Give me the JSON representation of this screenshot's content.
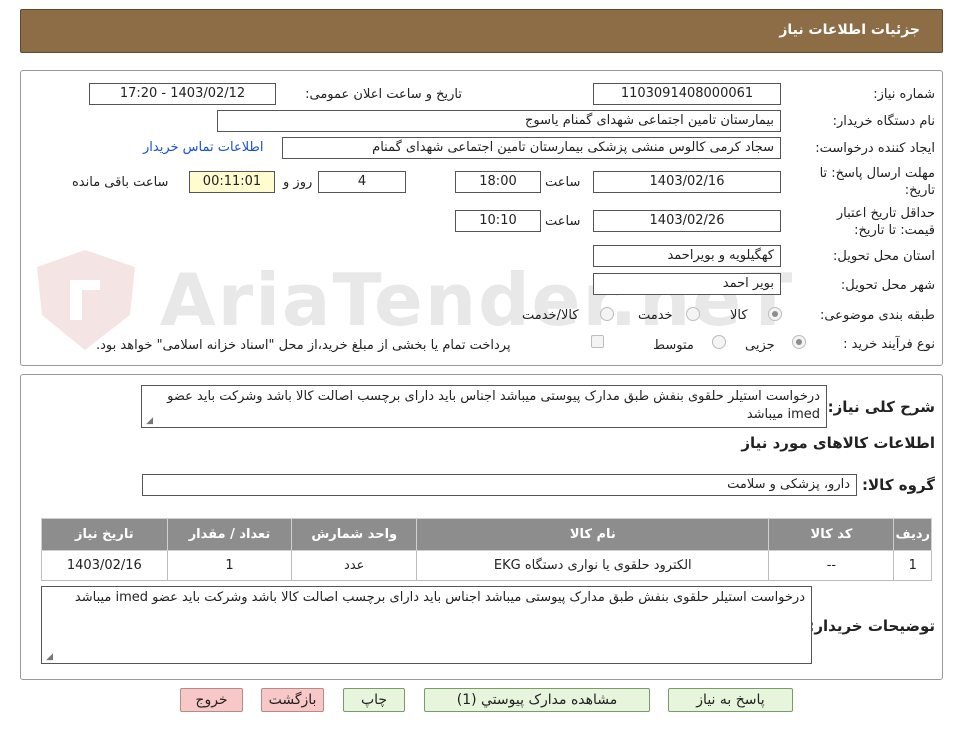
{
  "header": {
    "title": "جزئیات اطلاعات نیاز"
  },
  "labels": {
    "need_number": "شماره نیاز:",
    "announce_datetime": "تاریخ و ساعت اعلان عمومی:",
    "buyer_org": "نام دستگاه خریدار:",
    "creator": "ایجاد کننده درخواست:",
    "buyer_contact_link": "اطلاعات تماس خریدار",
    "reply_deadline_1": "مهلت ارسال پاسخ: تا",
    "reply_deadline_2": "تاریخ:",
    "time": "ساعت",
    "day_and": "روز و",
    "hours_left": "ساعت باقی مانده",
    "validity_1": "حداقل تاریخ اعتبار",
    "validity_2": "قیمت: تا تاریخ:",
    "province": "استان محل تحویل:",
    "city": "شهر محل تحویل:",
    "category": "طبقه بندی موضوعی:",
    "process_type": "نوع فرآیند خرید :",
    "general_desc": "شرح کلی نیاز:",
    "goods_info": "اطلاعات کالاهای مورد نیاز",
    "goods_group": "گروه کالا:",
    "buyer_notes": "توضیحات خریدار:"
  },
  "values": {
    "need_number": "1103091408000061",
    "announce_datetime": "1403/02/12 - 17:20",
    "buyer_org": "بیمارستان تامین اجتماعی شهدای گمنام یاسوج",
    "creator": "سجاد کرمی کالوس  منشی پزشکی  بیمارستان تامین اجتماعی شهدای گمنام",
    "reply_date": "1403/02/16",
    "reply_time": "18:00",
    "days": "4",
    "remaining": "00:11:01",
    "validity_date": "1403/02/26",
    "validity_time": "10:10",
    "province": "کهگیلویه و بویراحمد",
    "city": "بویر احمد",
    "general_desc": "درخواست استیلر حلقوی بنفش طبق مدارک پیوستی  میباشد اجناس باید دارای برچسب اصالت کالا باشد وشرکت باید عضو imed میباشد",
    "goods_group": "دارو، پزشکی و سلامت",
    "buyer_notes": "درخواست استیلر حلقوی بنفش طبق مدارک پیوستی  میباشد اجناس باید دارای برچسب اصالت کالا باشد وشرکت باید عضو imed میباشد"
  },
  "category_options": [
    "کالا",
    "خدمت",
    "کالا/خدمت"
  ],
  "category_selected": "کالا",
  "process_options": [
    "جزیی",
    "متوسط"
  ],
  "process_selected": "جزیی",
  "treasury_note": "پرداخت تمام یا بخشی از مبلغ خرید،از محل \"اسناد خزانه اسلامی\" خواهد بود.",
  "table": {
    "headers": [
      "ردیف",
      "کد کالا",
      "نام کالا",
      "واحد شمارش",
      "تعداد / مقدار",
      "تاریخ نیاز"
    ],
    "rows": [
      [
        "1",
        "--",
        "الکترود حلقوی یا نواری دستگاه EKG",
        "عدد",
        "1",
        "1403/02/16"
      ]
    ]
  },
  "buttons": {
    "reply": "پاسخ به نیاز",
    "attachments": "مشاهده مدارک پیوستي (1)",
    "print": "چاپ",
    "back": "بازگشت",
    "exit": "خروج"
  },
  "watermark": "AriaTender.neT"
}
